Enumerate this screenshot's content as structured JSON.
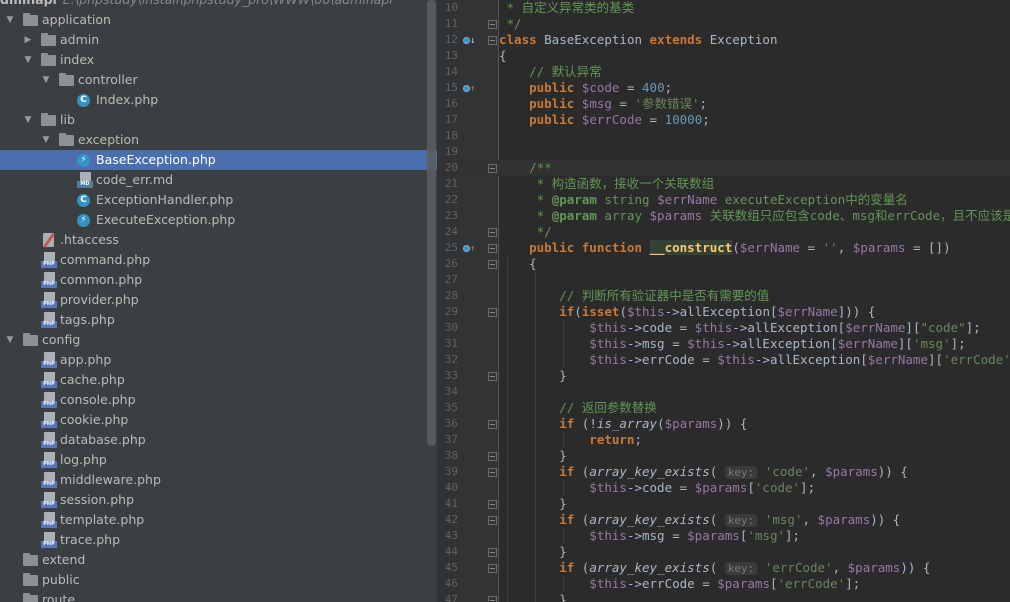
{
  "tree": {
    "root_label": "dminapi",
    "root_path": "E:\\phpstudy\\install\\phpstudy_pro\\WWW\\00\\adminapi",
    "items": [
      {
        "label": "application",
        "type": "folder",
        "depth": 0,
        "arrow": "down"
      },
      {
        "label": "admin",
        "type": "folder",
        "depth": 1,
        "arrow": "right"
      },
      {
        "label": "index",
        "type": "folder",
        "depth": 1,
        "arrow": "down"
      },
      {
        "label": "controller",
        "type": "folder",
        "depth": 2,
        "arrow": "down"
      },
      {
        "label": "Index.php",
        "type": "class",
        "depth": 3,
        "arrow": ""
      },
      {
        "label": "lib",
        "type": "folder",
        "depth": 1,
        "arrow": "down"
      },
      {
        "label": "exception",
        "type": "folder",
        "depth": 2,
        "arrow": "down"
      },
      {
        "label": "BaseException.php",
        "type": "exception",
        "depth": 3,
        "arrow": "",
        "selected": true
      },
      {
        "label": "code_err.md",
        "type": "md",
        "depth": 3,
        "arrow": ""
      },
      {
        "label": "ExceptionHandler.php",
        "type": "class",
        "depth": 3,
        "arrow": ""
      },
      {
        "label": "ExecuteException.php",
        "type": "exception",
        "depth": 3,
        "arrow": ""
      },
      {
        "label": ".htaccess",
        "type": "htaccess",
        "depth": 1,
        "arrow": ""
      },
      {
        "label": "command.php",
        "type": "php",
        "depth": 1,
        "arrow": ""
      },
      {
        "label": "common.php",
        "type": "php",
        "depth": 1,
        "arrow": ""
      },
      {
        "label": "provider.php",
        "type": "php",
        "depth": 1,
        "arrow": ""
      },
      {
        "label": "tags.php",
        "type": "php",
        "depth": 1,
        "arrow": ""
      },
      {
        "label": "config",
        "type": "folder",
        "depth": 0,
        "arrow": "down"
      },
      {
        "label": "app.php",
        "type": "php",
        "depth": 1,
        "arrow": ""
      },
      {
        "label": "cache.php",
        "type": "php",
        "depth": 1,
        "arrow": ""
      },
      {
        "label": "console.php",
        "type": "php",
        "depth": 1,
        "arrow": ""
      },
      {
        "label": "cookie.php",
        "type": "php",
        "depth": 1,
        "arrow": ""
      },
      {
        "label": "database.php",
        "type": "php",
        "depth": 1,
        "arrow": ""
      },
      {
        "label": "log.php",
        "type": "php",
        "depth": 1,
        "arrow": ""
      },
      {
        "label": "middleware.php",
        "type": "php",
        "depth": 1,
        "arrow": ""
      },
      {
        "label": "session.php",
        "type": "php",
        "depth": 1,
        "arrow": ""
      },
      {
        "label": "template.php",
        "type": "php",
        "depth": 1,
        "arrow": ""
      },
      {
        "label": "trace.php",
        "type": "php",
        "depth": 1,
        "arrow": ""
      },
      {
        "label": "extend",
        "type": "folder",
        "depth": 0,
        "arrow": ""
      },
      {
        "label": "public",
        "type": "folder",
        "depth": 0,
        "arrow": ""
      },
      {
        "label": "route",
        "type": "folder",
        "depth": 0,
        "arrow": ""
      }
    ]
  },
  "icon_text": {
    "php": "PHP",
    "md": "MD",
    "class": "C",
    "exception": "⚡"
  },
  "editor": {
    "file": "BaseException.php",
    "lines": [
      {
        "n": "10",
        "tokens": [
          [
            "cm",
            " * 自定义异常类的基类"
          ]
        ]
      },
      {
        "n": "11",
        "tokens": [
          [
            "cm",
            " */"
          ]
        ],
        "fold": true
      },
      {
        "n": "12",
        "tokens": [
          [
            "kw",
            "class "
          ],
          [
            "cls",
            "BaseException "
          ],
          [
            "kw",
            "extends "
          ],
          [
            "cls",
            "Exception"
          ]
        ],
        "mark": "down",
        "fold": true,
        "indent": -1
      },
      {
        "n": "13",
        "tokens": [
          [
            "cls",
            "{"
          ]
        ]
      },
      {
        "n": "14",
        "tokens": [
          [
            "cm",
            "    // 默认异常"
          ]
        ]
      },
      {
        "n": "15",
        "tokens": [
          [
            "kw",
            "    public "
          ],
          [
            "var",
            "$code"
          ],
          [
            "cls",
            " = "
          ],
          [
            "num",
            "400"
          ],
          [
            "cls",
            ";"
          ]
        ],
        "mark": "up"
      },
      {
        "n": "16",
        "tokens": [
          [
            "kw",
            "    public "
          ],
          [
            "var",
            "$msg"
          ],
          [
            "cls",
            " = "
          ],
          [
            "str",
            "'参数错误'"
          ],
          [
            "cls",
            ";"
          ]
        ]
      },
      {
        "n": "17",
        "tokens": [
          [
            "kw",
            "    public "
          ],
          [
            "var",
            "$errCode"
          ],
          [
            "cls",
            " = "
          ],
          [
            "num",
            "10000"
          ],
          [
            "cls",
            ";"
          ]
        ]
      },
      {
        "n": "18",
        "tokens": [
          [
            "cls",
            ""
          ]
        ]
      },
      {
        "n": "19",
        "tokens": [
          [
            "cls",
            ""
          ]
        ]
      },
      {
        "n": "20",
        "tokens": [
          [
            "cm",
            "    /**"
          ]
        ],
        "fold": true,
        "hl": true
      },
      {
        "n": "21",
        "tokens": [
          [
            "cm",
            "     * 构造函数，接收一个关联数组"
          ]
        ]
      },
      {
        "n": "22",
        "tokens": [
          [
            "cm",
            "     * "
          ],
          [
            "doctag",
            "@param"
          ],
          [
            "doctype",
            " string "
          ],
          [
            "var",
            "$errName"
          ],
          [
            "cm",
            " executeException中的变量名"
          ]
        ]
      },
      {
        "n": "23",
        "tokens": [
          [
            "cm",
            "     * "
          ],
          [
            "doctag",
            "@param"
          ],
          [
            "doctype",
            " array "
          ],
          [
            "var",
            "$params"
          ],
          [
            "cm",
            " 关联数组只应包含code、msg和errCode，且不应该是空值"
          ]
        ]
      },
      {
        "n": "24",
        "tokens": [
          [
            "cm",
            "     */"
          ]
        ],
        "fold": true
      },
      {
        "n": "25",
        "tokens": [
          [
            "kw",
            "    public function "
          ],
          [
            "fnb",
            "__construct"
          ],
          [
            "cls",
            "("
          ],
          [
            "var",
            "$errName"
          ],
          [
            "cls",
            " = "
          ],
          [
            "str",
            "''"
          ],
          [
            "cls",
            ", "
          ],
          [
            "var",
            "$params"
          ],
          [
            "cls",
            " = [])"
          ]
        ],
        "mark": "up",
        "fold": true
      },
      {
        "n": "26",
        "tokens": [
          [
            "cls",
            "    {"
          ]
        ],
        "fold": true
      },
      {
        "n": "27",
        "tokens": [
          [
            "cls",
            ""
          ]
        ]
      },
      {
        "n": "28",
        "tokens": [
          [
            "cm",
            "        // 判断所有验证器中是否有需要的值"
          ]
        ]
      },
      {
        "n": "29",
        "tokens": [
          [
            "kw",
            "        if"
          ],
          [
            "cls",
            "("
          ],
          [
            "kw",
            "isset"
          ],
          [
            "cls",
            "("
          ],
          [
            "var",
            "$this"
          ],
          [
            "cls",
            "->allException["
          ],
          [
            "var",
            "$errName"
          ],
          [
            "cls",
            "])) {"
          ]
        ],
        "fold": true
      },
      {
        "n": "30",
        "tokens": [
          [
            "var",
            "            $this"
          ],
          [
            "cls",
            "->code = "
          ],
          [
            "var",
            "$this"
          ],
          [
            "cls",
            "->allException["
          ],
          [
            "var",
            "$errName"
          ],
          [
            "cls",
            "]["
          ],
          [
            "str",
            "\"code\""
          ],
          [
            "cls",
            "];"
          ]
        ]
      },
      {
        "n": "31",
        "tokens": [
          [
            "var",
            "            $this"
          ],
          [
            "cls",
            "->msg = "
          ],
          [
            "var",
            "$this"
          ],
          [
            "cls",
            "->allException["
          ],
          [
            "var",
            "$errName"
          ],
          [
            "cls",
            "]["
          ],
          [
            "str",
            "'msg'"
          ],
          [
            "cls",
            "];"
          ]
        ]
      },
      {
        "n": "32",
        "tokens": [
          [
            "var",
            "            $this"
          ],
          [
            "cls",
            "->errCode = "
          ],
          [
            "var",
            "$this"
          ],
          [
            "cls",
            "->allException["
          ],
          [
            "var",
            "$errName"
          ],
          [
            "cls",
            "]["
          ],
          [
            "str",
            "'errCode'"
          ],
          [
            "cls",
            "];"
          ]
        ]
      },
      {
        "n": "33",
        "tokens": [
          [
            "cls",
            "        }"
          ]
        ],
        "fold": true
      },
      {
        "n": "34",
        "tokens": [
          [
            "cls",
            ""
          ]
        ]
      },
      {
        "n": "35",
        "tokens": [
          [
            "cm",
            "        // 返回参数替换"
          ]
        ]
      },
      {
        "n": "36",
        "tokens": [
          [
            "kw",
            "        if "
          ],
          [
            "cls",
            "(!"
          ],
          [
            "bif",
            "is_array"
          ],
          [
            "cls",
            "("
          ],
          [
            "var",
            "$params"
          ],
          [
            "cls",
            ")) {"
          ]
        ],
        "fold": true
      },
      {
        "n": "37",
        "tokens": [
          [
            "kw",
            "            return"
          ],
          [
            "cls",
            ";"
          ]
        ]
      },
      {
        "n": "38",
        "tokens": [
          [
            "cls",
            "        }"
          ]
        ],
        "fold": true
      },
      {
        "n": "39",
        "tokens": [
          [
            "kw",
            "        if "
          ],
          [
            "cls",
            "("
          ],
          [
            "bif",
            "array_key_exists"
          ],
          [
            "cls",
            "( "
          ],
          [
            "hint",
            "key:"
          ],
          [
            "cls",
            " "
          ],
          [
            "str",
            "'code'"
          ],
          [
            "cls",
            ", "
          ],
          [
            "var",
            "$params"
          ],
          [
            "cls",
            ")) {"
          ]
        ],
        "fold": true
      },
      {
        "n": "40",
        "tokens": [
          [
            "var",
            "            $this"
          ],
          [
            "cls",
            "->code = "
          ],
          [
            "var",
            "$params"
          ],
          [
            "cls",
            "["
          ],
          [
            "str",
            "'code'"
          ],
          [
            "cls",
            "];"
          ]
        ]
      },
      {
        "n": "41",
        "tokens": [
          [
            "cls",
            "        }"
          ]
        ],
        "fold": true
      },
      {
        "n": "42",
        "tokens": [
          [
            "kw",
            "        if "
          ],
          [
            "cls",
            "("
          ],
          [
            "bif",
            "array_key_exists"
          ],
          [
            "cls",
            "( "
          ],
          [
            "hint",
            "key:"
          ],
          [
            "cls",
            " "
          ],
          [
            "str",
            "'msg'"
          ],
          [
            "cls",
            ", "
          ],
          [
            "var",
            "$params"
          ],
          [
            "cls",
            ")) {"
          ]
        ],
        "fold": true
      },
      {
        "n": "43",
        "tokens": [
          [
            "var",
            "            $this"
          ],
          [
            "cls",
            "->msg = "
          ],
          [
            "var",
            "$params"
          ],
          [
            "cls",
            "["
          ],
          [
            "str",
            "'msg'"
          ],
          [
            "cls",
            "];"
          ]
        ]
      },
      {
        "n": "44",
        "tokens": [
          [
            "cls",
            "        }"
          ]
        ],
        "fold": true
      },
      {
        "n": "45",
        "tokens": [
          [
            "kw",
            "        if "
          ],
          [
            "cls",
            "("
          ],
          [
            "bif",
            "array_key_exists"
          ],
          [
            "cls",
            "( "
          ],
          [
            "hint",
            "key:"
          ],
          [
            "cls",
            " "
          ],
          [
            "str",
            "'errCode'"
          ],
          [
            "cls",
            ", "
          ],
          [
            "var",
            "$params"
          ],
          [
            "cls",
            ")) {"
          ]
        ],
        "fold": true
      },
      {
        "n": "46",
        "tokens": [
          [
            "var",
            "            $this"
          ],
          [
            "cls",
            "->errCode = "
          ],
          [
            "var",
            "$params"
          ],
          [
            "cls",
            "["
          ],
          [
            "str",
            "'errCode'"
          ],
          [
            "cls",
            "];"
          ]
        ]
      },
      {
        "n": "47",
        "tokens": [
          [
            "cls",
            "        }"
          ]
        ],
        "fold": true
      }
    ]
  },
  "colors": {
    "tree_bg": "#3c3f41",
    "editor_bg": "#2b2b2b",
    "gutter_bg": "#313335",
    "selection": "#4b6eaf",
    "keyword": "#cc7832",
    "variable": "#9876aa",
    "string": "#6a8759",
    "number": "#6897bb",
    "comment": "#629755",
    "function": "#ffc66d"
  }
}
